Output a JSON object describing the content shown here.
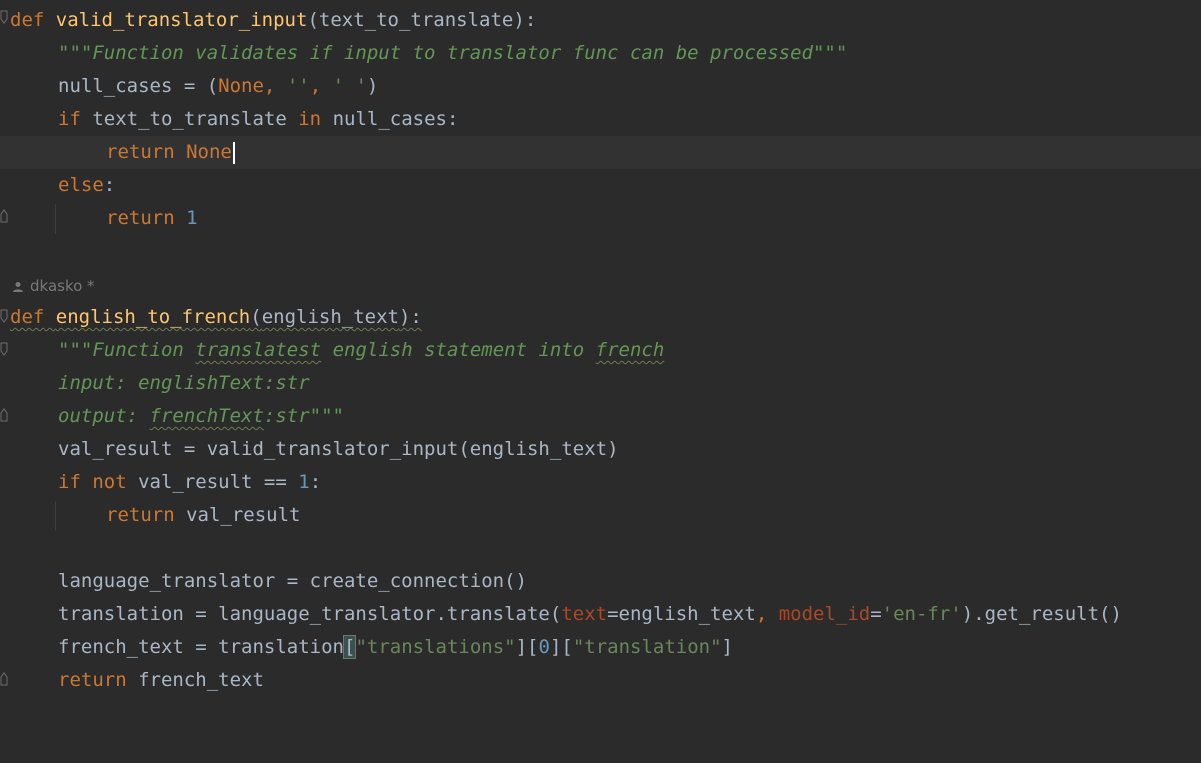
{
  "author": {
    "name": "dkasko *"
  },
  "func1": {
    "def_kw": "def",
    "name": "valid_translator_input",
    "open_paren": "(",
    "param": "text_to_translate",
    "close": "):",
    "docstring": "\"\"\"Function validates if input to translator func can be processed\"\"\"",
    "null_assign": "null_cases = (",
    "null_none": "None",
    "null_comma1": ", ",
    "null_s1": "''",
    "null_comma2": ", ",
    "null_s2": "' '",
    "null_close": ")",
    "if_kw": "if",
    "if_var": " text_to_translate ",
    "in_kw": "in",
    "if_rest": " null_cases:",
    "return_kw": "return",
    "return_none": "None",
    "else_kw": "else",
    "else_colon": ":",
    "return2_kw": "return",
    "return2_val": "1"
  },
  "func2": {
    "def_kw": "def",
    "name": "english_to_french",
    "open_paren": "(",
    "param": "english_text",
    "close": "):",
    "doc1_a": "\"\"\"Function ",
    "doc1_b": "translatest",
    "doc1_c": " english statement into ",
    "doc1_d": "french",
    "doc2": "input: englishText:str",
    "doc3_a": "output: ",
    "doc3_b": "frenchText",
    "doc3_c": ":str\"\"\"",
    "val_line": "val_result = valid_translator_input(english_text)",
    "if_kw": "if",
    "not_kw": " not",
    "if_mid": " val_result == ",
    "if_num": "1",
    "if_colon": ":",
    "return_kw": "return",
    "return_val": " val_result",
    "lt_line": "language_translator = create_connection()",
    "tr_a": "translation = language_translator.translate(",
    "tr_param1": "text",
    "tr_b": "=english_text",
    "tr_comma": ", ",
    "tr_param2": "model_id",
    "tr_eq": "=",
    "tr_str": "'en-fr'",
    "tr_c": ").get_result()",
    "ft_a": "french_text = translation",
    "ft_bracket": "[",
    "ft_s1": "\"translations\"",
    "ft_b": "][",
    "ft_num": "0",
    "ft_c": "][",
    "ft_s2": "\"translation\"",
    "ft_d": "]",
    "ret_kw": "return",
    "ret_val": " french_text"
  },
  "colors": {
    "background": "#2b2b2b",
    "keyword": "#cc7832",
    "function": "#ffc66d",
    "docstring": "#629755",
    "string": "#6a8759",
    "number": "#6897bb",
    "parameter": "#aa4926",
    "text": "#a9b7c6"
  }
}
